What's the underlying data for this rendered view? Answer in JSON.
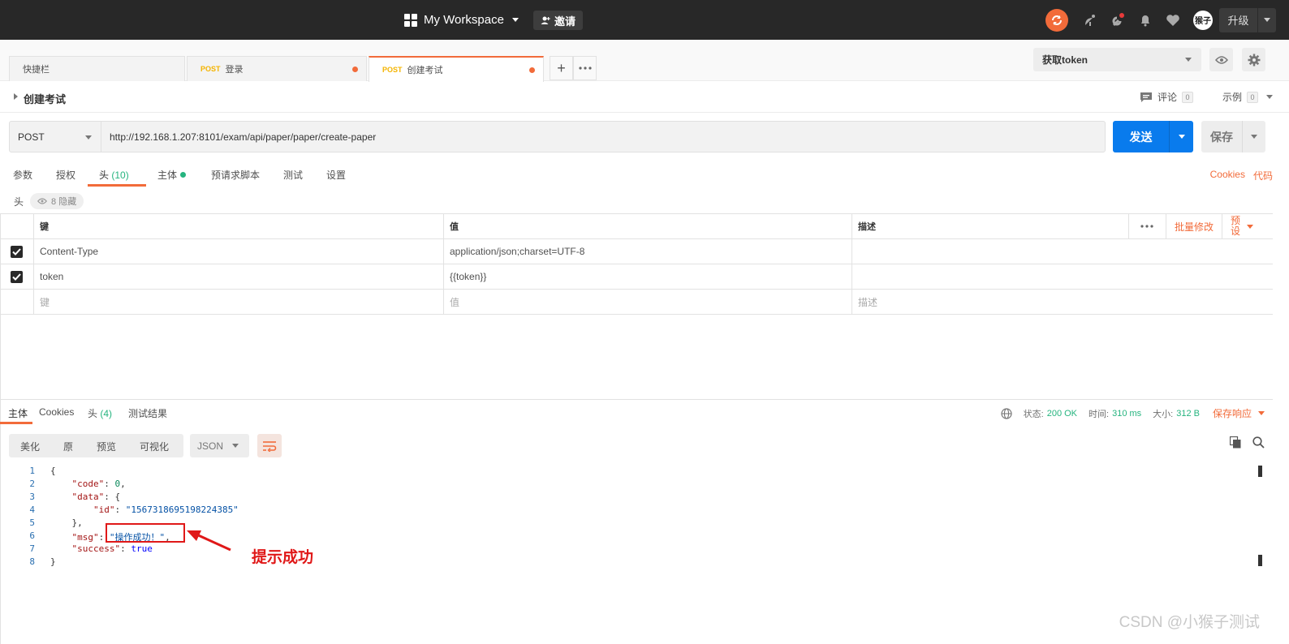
{
  "topbar": {
    "workspace": "My Workspace",
    "invite": "邀请",
    "avatar_text": "猴子",
    "upgrade": "升级",
    "icons": [
      "sync-icon",
      "satellite-icon",
      "wrench-icon",
      "bell-icon",
      "heart-icon"
    ]
  },
  "tabs": [
    {
      "label": "快捷栏",
      "method": ""
    },
    {
      "label": "登录",
      "method": "POST"
    },
    {
      "label": "创建考试",
      "method": "POST"
    }
  ],
  "environment": {
    "selected": "获取token"
  },
  "request": {
    "name": "创建考试",
    "comments_label": "评论",
    "comments_count": "0",
    "examples_label": "示例",
    "examples_count": "0",
    "method": "POST",
    "url": "http://192.168.1.207:8101/exam/api/paper/paper/create-paper",
    "send": "发送",
    "save": "保存"
  },
  "req_tabs": {
    "params": "参数",
    "auth": "授权",
    "headers": "头",
    "headers_count": "(10)",
    "body": "主体",
    "prerequest": "预请求脚本",
    "tests": "测试",
    "settings": "设置",
    "cookies": "Cookies",
    "code": "代码"
  },
  "headers_section": {
    "label": "头",
    "hidden": "8 隐藏"
  },
  "headers_table": {
    "col_key": "键",
    "col_value": "值",
    "col_desc": "描述",
    "bulk_edit": "批量修改",
    "presets": "预\n设",
    "rows": [
      {
        "key": "Content-Type",
        "value": "application/json;charset=UTF-8",
        "desc": "",
        "checked": true
      },
      {
        "key": "token",
        "value": "{{token}}",
        "desc": "",
        "checked": true
      }
    ],
    "placeholder_key": "键",
    "placeholder_value": "值",
    "placeholder_desc": "描述"
  },
  "response": {
    "tabs": {
      "body": "主体",
      "cookies": "Cookies",
      "headers": "头",
      "headers_count": "(4)",
      "tests": "测试结果"
    },
    "status_label": "状态:",
    "status_value": "200 OK",
    "time_label": "时间:",
    "time_value": "310 ms",
    "size_label": "大小:",
    "size_value": "312 B",
    "save_response": "保存响应",
    "format_tabs": [
      "美化",
      "原",
      "预览",
      "可视化"
    ],
    "language": "JSON",
    "code_lines": [
      {
        "n": "1",
        "parts": [
          [
            "p",
            "{"
          ]
        ]
      },
      {
        "n": "2",
        "parts": [
          [
            "p",
            "    "
          ],
          [
            "k",
            "\"code\""
          ],
          [
            "p",
            ": "
          ],
          [
            "n",
            "0"
          ],
          [
            "p",
            ","
          ]
        ]
      },
      {
        "n": "3",
        "parts": [
          [
            "p",
            "    "
          ],
          [
            "k",
            "\"data\""
          ],
          [
            "p",
            ": {"
          ]
        ]
      },
      {
        "n": "4",
        "parts": [
          [
            "p",
            "        "
          ],
          [
            "k",
            "\"id\""
          ],
          [
            "p",
            ": "
          ],
          [
            "s",
            "\"1567318695198224385\""
          ]
        ]
      },
      {
        "n": "5",
        "parts": [
          [
            "p",
            "    },"
          ]
        ]
      },
      {
        "n": "6",
        "parts": [
          [
            "p",
            "    "
          ],
          [
            "k",
            "\"msg\""
          ],
          [
            "p",
            ": "
          ],
          [
            "s",
            "\"操作成功！\""
          ],
          [
            "p",
            ","
          ]
        ]
      },
      {
        "n": "7",
        "parts": [
          [
            "p",
            "    "
          ],
          [
            "k",
            "\"success\""
          ],
          [
            "p",
            ": "
          ],
          [
            "b",
            "true"
          ]
        ]
      },
      {
        "n": "8",
        "parts": [
          [
            "p",
            "}"
          ]
        ]
      }
    ]
  },
  "annotation": "提示成功",
  "watermark": "CSDN @小猴子测试"
}
